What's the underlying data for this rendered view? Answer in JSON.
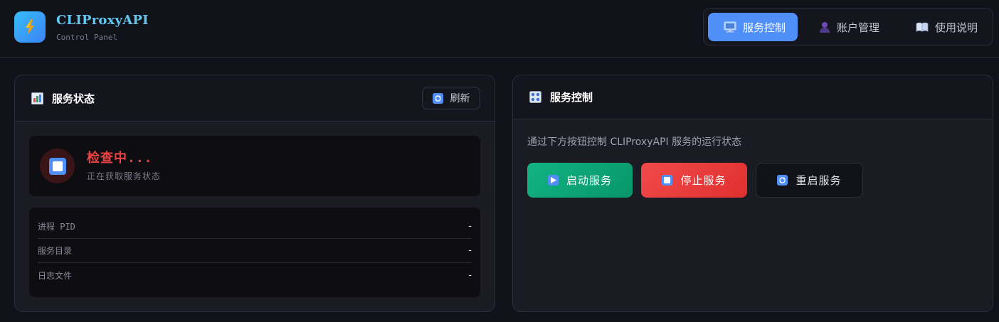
{
  "header": {
    "app_title": "CLIProxyAPI",
    "subtitle": "Control Panel",
    "logo_icon": "lightning-bolt-icon"
  },
  "nav": {
    "items": [
      {
        "label": "服务控制",
        "icon": "monitor-icon",
        "active": true
      },
      {
        "label": "账户管理",
        "icon": "user-icon",
        "active": false
      },
      {
        "label": "使用说明",
        "icon": "book-icon",
        "active": false
      }
    ]
  },
  "status_panel": {
    "title": "服务状态",
    "title_icon": "bar-chart-icon",
    "refresh_label": "刷新",
    "status_text": "检查中...",
    "status_sub": "正在获取服务状态",
    "rows": [
      {
        "label": "进程 PID",
        "value": "-"
      },
      {
        "label": "服务目录",
        "value": "-"
      },
      {
        "label": "日志文件",
        "value": "-"
      }
    ]
  },
  "control_panel": {
    "title": "服务控制",
    "title_icon": "control-knobs-icon",
    "description": "通过下方按钮控制 CLIProxyAPI 服务的运行状态",
    "start_label": "启动服务",
    "stop_label": "停止服务",
    "restart_label": "重启服务"
  },
  "colors": {
    "accent": "#4f8ff7",
    "brand_text": "#5ec8f0",
    "status_red": "#ef4444",
    "start_green": "#10a777",
    "stop_red": "#e8393a"
  }
}
